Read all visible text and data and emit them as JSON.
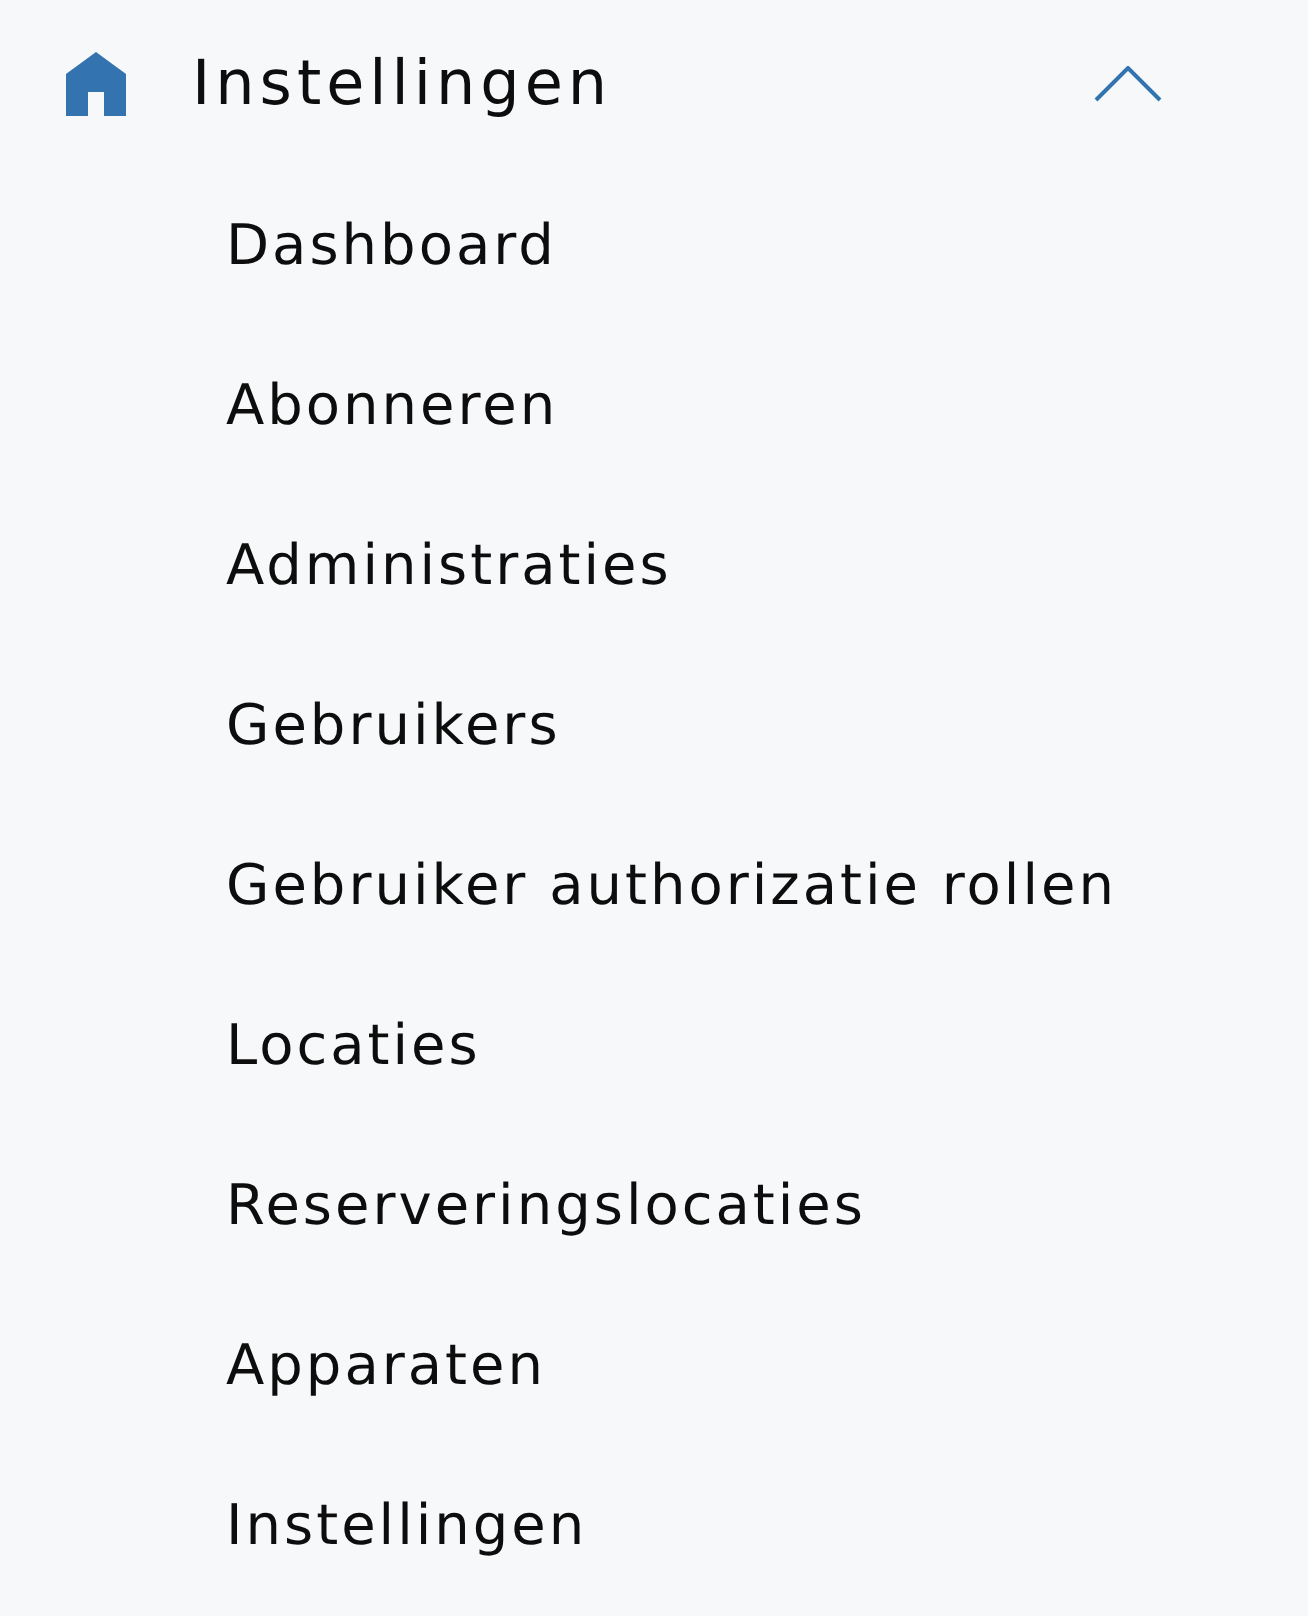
{
  "menu": {
    "title": "Instellingen",
    "expanded": true,
    "items": [
      {
        "label": "Dashboard"
      },
      {
        "label": "Abonneren"
      },
      {
        "label": "Administraties"
      },
      {
        "label": "Gebruikers"
      },
      {
        "label": "Gebruiker authorizatie rollen"
      },
      {
        "label": "Locaties"
      },
      {
        "label": "Reserveringslocaties"
      },
      {
        "label": "Apparaten"
      },
      {
        "label": "Instellingen"
      }
    ]
  }
}
